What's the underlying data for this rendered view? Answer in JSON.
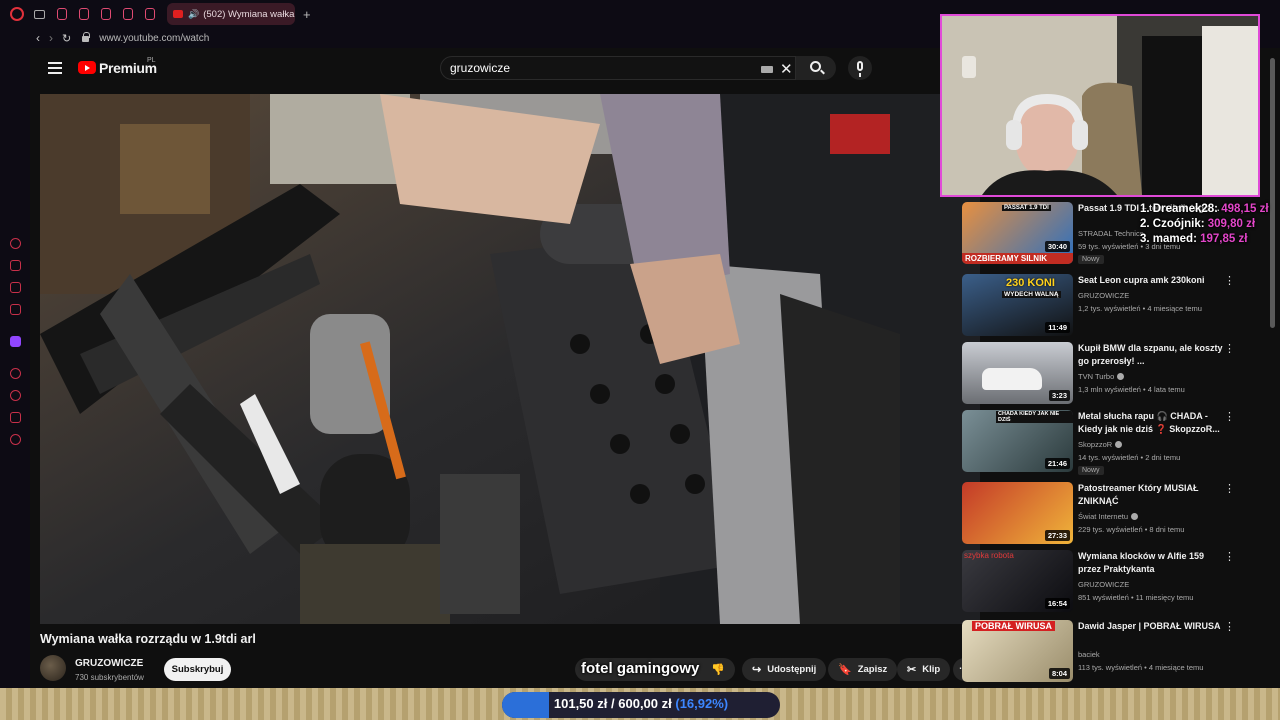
{
  "browser": {
    "tab_title": "(502) Wymiana wałka r",
    "url": "www.youtube.com/watch",
    "new_tab": "+"
  },
  "youtube": {
    "logo_text": "Premium",
    "logo_region": "PL",
    "search_value": "gruzowicze",
    "video": {
      "title": "Wymiana wałka rozrządu w 1.9tdi arl",
      "channel": "GRUZOWICZE",
      "subscribers": "730 subskrybentów",
      "subscribe_label": "Subskrybuj",
      "actions": {
        "share": "Udostępnij",
        "save": "Zapisz",
        "clip": "Klip"
      },
      "overlay_text": "fotel gamingowy"
    },
    "recommendations": [
      {
        "title": "Passat 1.9 TDI – ten silnik tego ...",
        "thumb_text": "ROZBIERAMY SILNIK",
        "thumb_top": "PASSAT 1.9 TDI",
        "channel": "STRADAL Technics",
        "meta": "59 tys. wyświetleń • 3 dni temu",
        "duration": "30:40",
        "new": "Nowy"
      },
      {
        "title": "Seat Leon cupra amk 230koni",
        "thumb_text": "230 KONI",
        "thumb_sub": "WYDECH WALNĄ",
        "channel": "GRUZOWICZE",
        "meta": "1,2 tys. wyświetleń • 4 miesiące temu",
        "duration": "11:49"
      },
      {
        "title": "Kupił BMW dla szpanu, ale koszty go przerosły! ...",
        "channel": "TVN Turbo",
        "meta": "1,3 mln wyświetleń • 4 lata temu",
        "duration": "3:23"
      },
      {
        "title": "Metal słucha rapu 🎧 CHADA - Kiedy jak nie dziś ❓ SkopzzoR...",
        "thumb_text": "CHADA KIEDY JAK NIE DZIŚ",
        "channel": "SkopzzoR",
        "meta": "14 tys. wyświetleń • 2 dni temu",
        "duration": "21:46",
        "new": "Nowy"
      },
      {
        "title": "Patostreamer Który MUSIAŁ ZNIKNĄĆ",
        "channel": "Świat Internetu",
        "meta": "229 tys. wyświetleń • 8 dni temu",
        "duration": "27:33"
      },
      {
        "title": "Wymiana klocków w Alfie 159 przez Praktykanta",
        "thumb_text": "szybka robota",
        "channel": "GRUZOWICZE",
        "meta": "851 wyświetleń • 11 miesięcy temu",
        "duration": "16:54"
      },
      {
        "title": "Dawid Jasper | POBRAŁ WIRUSA",
        "thumb_text": "POBRAŁ WIRUSA",
        "channel": "baciek",
        "meta": "113 tys. wyświetleń • 4 miesiące temu",
        "duration": "8:04"
      }
    ]
  },
  "stream": {
    "top_donors": [
      {
        "rank": "1.",
        "name": "Dreamek28:",
        "amount": "498,15 zł"
      },
      {
        "rank": "2.",
        "name": "Czoójnik:",
        "amount": "309,80 zł"
      },
      {
        "rank": "3.",
        "name": "mamed:",
        "amount": "197,85 zł"
      }
    ],
    "goal": {
      "current": "101,50 zł",
      "target": "600,00 zł",
      "percent_text": "(16,92%)",
      "percent": 16.92,
      "separator": "/"
    }
  },
  "colors": {
    "accent_pink": "#e346c9",
    "yt_red": "#ff0000",
    "goal_blue": "#2b6fd9"
  }
}
